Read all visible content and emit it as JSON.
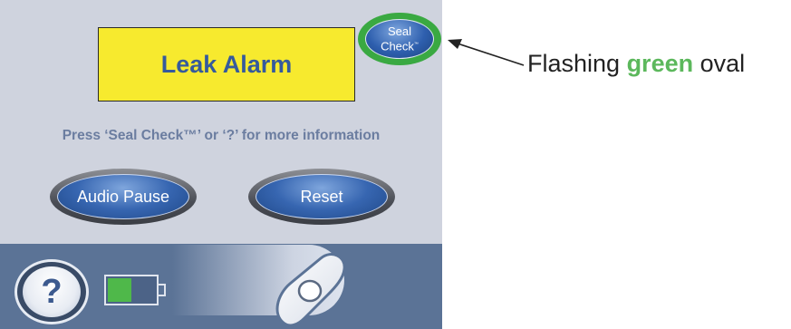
{
  "screen": {
    "alarm_text": "Leak Alarm",
    "seal_check": {
      "line1": "Seal",
      "line2": "Check",
      "tm": "™"
    },
    "info_text": "Press ‘Seal Check™’ or  ‘?’ for more information",
    "buttons": {
      "audio_pause": "Audio Pause",
      "reset": "Reset"
    },
    "help_label": "?",
    "battery_level": 0.5
  },
  "annotation": {
    "prefix": "Flashing ",
    "highlight": "green",
    "suffix": " oval"
  },
  "colors": {
    "alarm_background": "#f7ea2e",
    "alarm_text": "#365a9c",
    "highlight_ring": "#3aa942",
    "button_blue": "#3766b1",
    "panel_background": "#cfd3de",
    "bottom_bar": "#5b7396",
    "battery_fill": "#4fb84a",
    "annotation_green": "#5cb85c"
  }
}
